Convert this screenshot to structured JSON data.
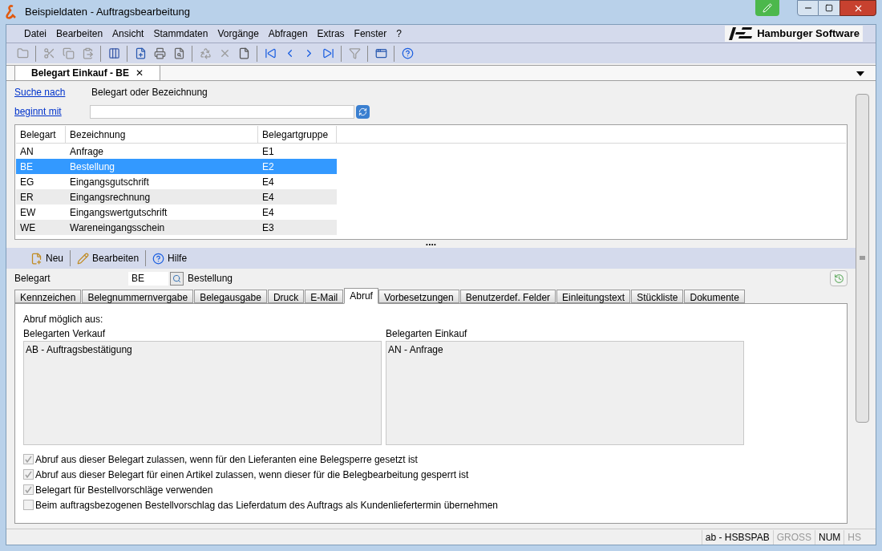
{
  "window": {
    "title": "Beispieldaten - Auftragsbearbeitung"
  },
  "menu": [
    "Datei",
    "Bearbeiten",
    "Ansicht",
    "Stammdaten",
    "Vorgänge",
    "Abfragen",
    "Extras",
    "Fenster",
    "?"
  ],
  "logo": {
    "text": "Hamburger Software"
  },
  "document_tab": {
    "label": "Belegart Einkauf - BE",
    "close": "✕"
  },
  "search": {
    "mode_link": "Suche nach",
    "mode_value": "Belegart oder Bezeichnung",
    "match_link": "beginnt mit"
  },
  "table": {
    "columns": [
      "Belegart",
      "Bezeichnung",
      "Belegartgruppe"
    ],
    "rows": [
      {
        "cells": [
          "AN",
          "Anfrage",
          "E1"
        ],
        "selected": false
      },
      {
        "cells": [
          "BE",
          "Bestellung",
          "E2"
        ],
        "selected": true
      },
      {
        "cells": [
          "EG",
          "Eingangsgutschrift",
          "E4"
        ],
        "selected": false
      },
      {
        "cells": [
          "ER",
          "Eingangsrechnung",
          "E4"
        ],
        "selected": false
      },
      {
        "cells": [
          "EW",
          "Eingangswertgutschrift",
          "E4"
        ],
        "selected": false
      },
      {
        "cells": [
          "WE",
          "Wareneingangsschein",
          "E3"
        ],
        "selected": false
      }
    ]
  },
  "splitter": "....",
  "actions": [
    "Neu",
    "Bearbeiten",
    "Hilfe"
  ],
  "belegart": {
    "label": "Belegart",
    "value": "BE",
    "description": "Bestellung"
  },
  "tabs": [
    {
      "label": "Kennzeichen",
      "selected": false
    },
    {
      "label": "Belegnummernvergabe",
      "selected": false
    },
    {
      "label": "Belegausgabe",
      "selected": false
    },
    {
      "label": "Druck",
      "selected": false
    },
    {
      "label": "E-Mail",
      "selected": false
    },
    {
      "label": "Abruf",
      "selected": true
    },
    {
      "label": "Vorbesetzungen",
      "selected": false
    },
    {
      "label": "Benutzerdef. Felder",
      "selected": false
    },
    {
      "label": "Einleitungstext",
      "selected": false
    },
    {
      "label": "Stückliste",
      "selected": false
    },
    {
      "label": "Dokumente",
      "selected": false
    }
  ],
  "abruf": {
    "heading": "Abruf möglich aus:",
    "lists": [
      {
        "title": "Belegarten Verkauf",
        "items": [
          "AB - Auftragsbestätigung"
        ]
      },
      {
        "title": "Belegarten Einkauf",
        "items": [
          "AN - Anfrage"
        ]
      }
    ],
    "options": [
      {
        "label": "Abruf aus dieser Belegart zulassen, wenn für den Lieferanten eine Belegsperre gesetzt ist",
        "checked": true
      },
      {
        "label": "Abruf aus dieser Belegart für einen Artikel zulassen, wenn dieser für die Belegbearbeitung gesperrt ist",
        "checked": true
      },
      {
        "label": "Belegart für Bestellvorschläge verwenden",
        "checked": true
      },
      {
        "label": "Beim auftragsbezogenen Bestellvorschlag das Lieferdatum des Auftrags als Kundenliefertermin übernehmen",
        "checked": false
      }
    ]
  },
  "status_bar": [
    {
      "text": "ab - HSBSPAB",
      "active": true
    },
    {
      "text": "GROSS",
      "active": false
    },
    {
      "text": "NUM",
      "active": true
    },
    {
      "text": "HS",
      "active": false
    }
  ]
}
